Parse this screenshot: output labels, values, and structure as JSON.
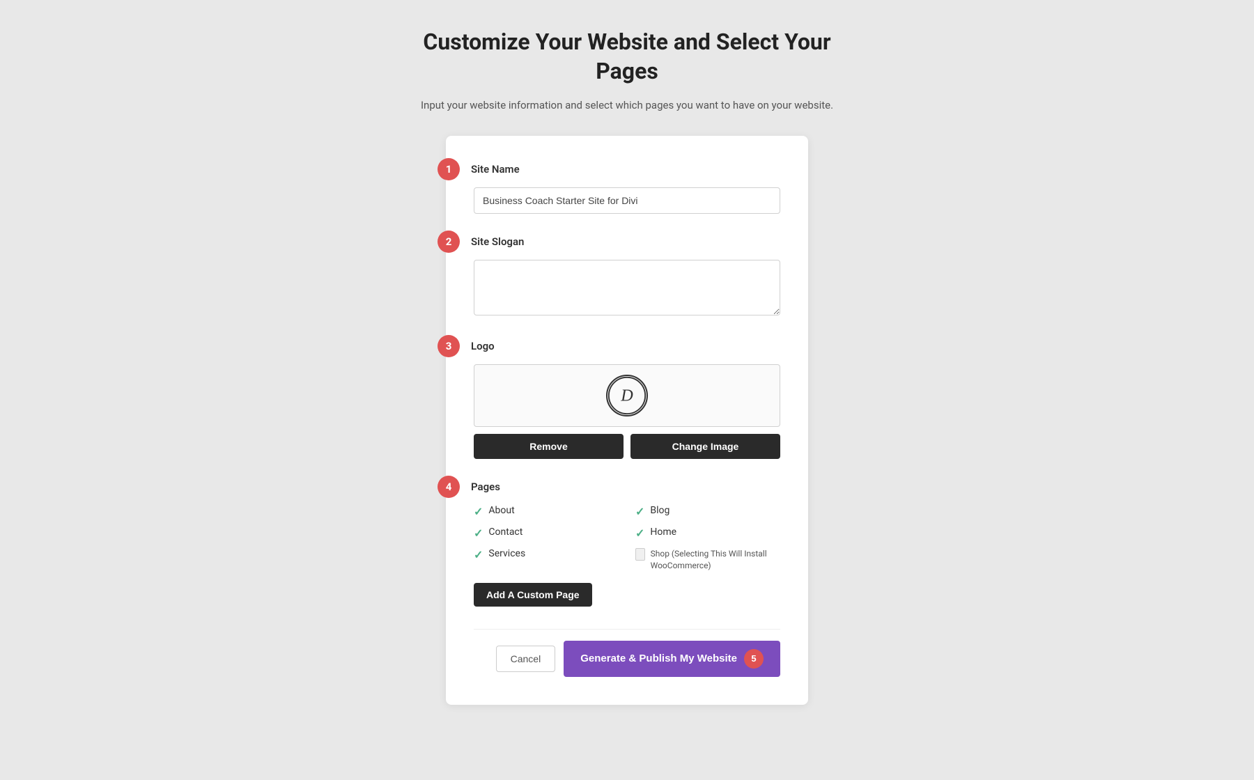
{
  "header": {
    "title": "Customize Your Website and Select Your Pages",
    "subtitle": "Input your website information and select which pages you want to have on your website."
  },
  "steps": {
    "step1_label": "Site Name",
    "step2_label": "Site Slogan",
    "step3_label": "Logo",
    "step4_label": "Pages",
    "step1_badge": "1",
    "step2_badge": "2",
    "step3_badge": "3",
    "step4_badge": "4",
    "step5_badge": "5"
  },
  "inputs": {
    "site_name_value": "Business Coach Starter Site for Divi",
    "site_name_placeholder": "Business Coach Starter Site for Divi",
    "site_slogan_placeholder": ""
  },
  "logo": {
    "icon_letter": "D",
    "remove_button": "Remove",
    "change_button": "Change Image"
  },
  "pages": [
    {
      "name": "About",
      "checked": true,
      "col": 1
    },
    {
      "name": "Blog",
      "checked": true,
      "col": 2
    },
    {
      "name": "Contact",
      "checked": true,
      "col": 1
    },
    {
      "name": "Home",
      "checked": true,
      "col": 2
    },
    {
      "name": "Services",
      "checked": true,
      "col": 1
    },
    {
      "name": "Shop (Selecting This Will Install WooCommerce)",
      "checked": false,
      "col": 2
    }
  ],
  "buttons": {
    "add_custom_page": "Add A Custom Page",
    "cancel": "Cancel",
    "generate": "Generate & Publish My Website"
  }
}
